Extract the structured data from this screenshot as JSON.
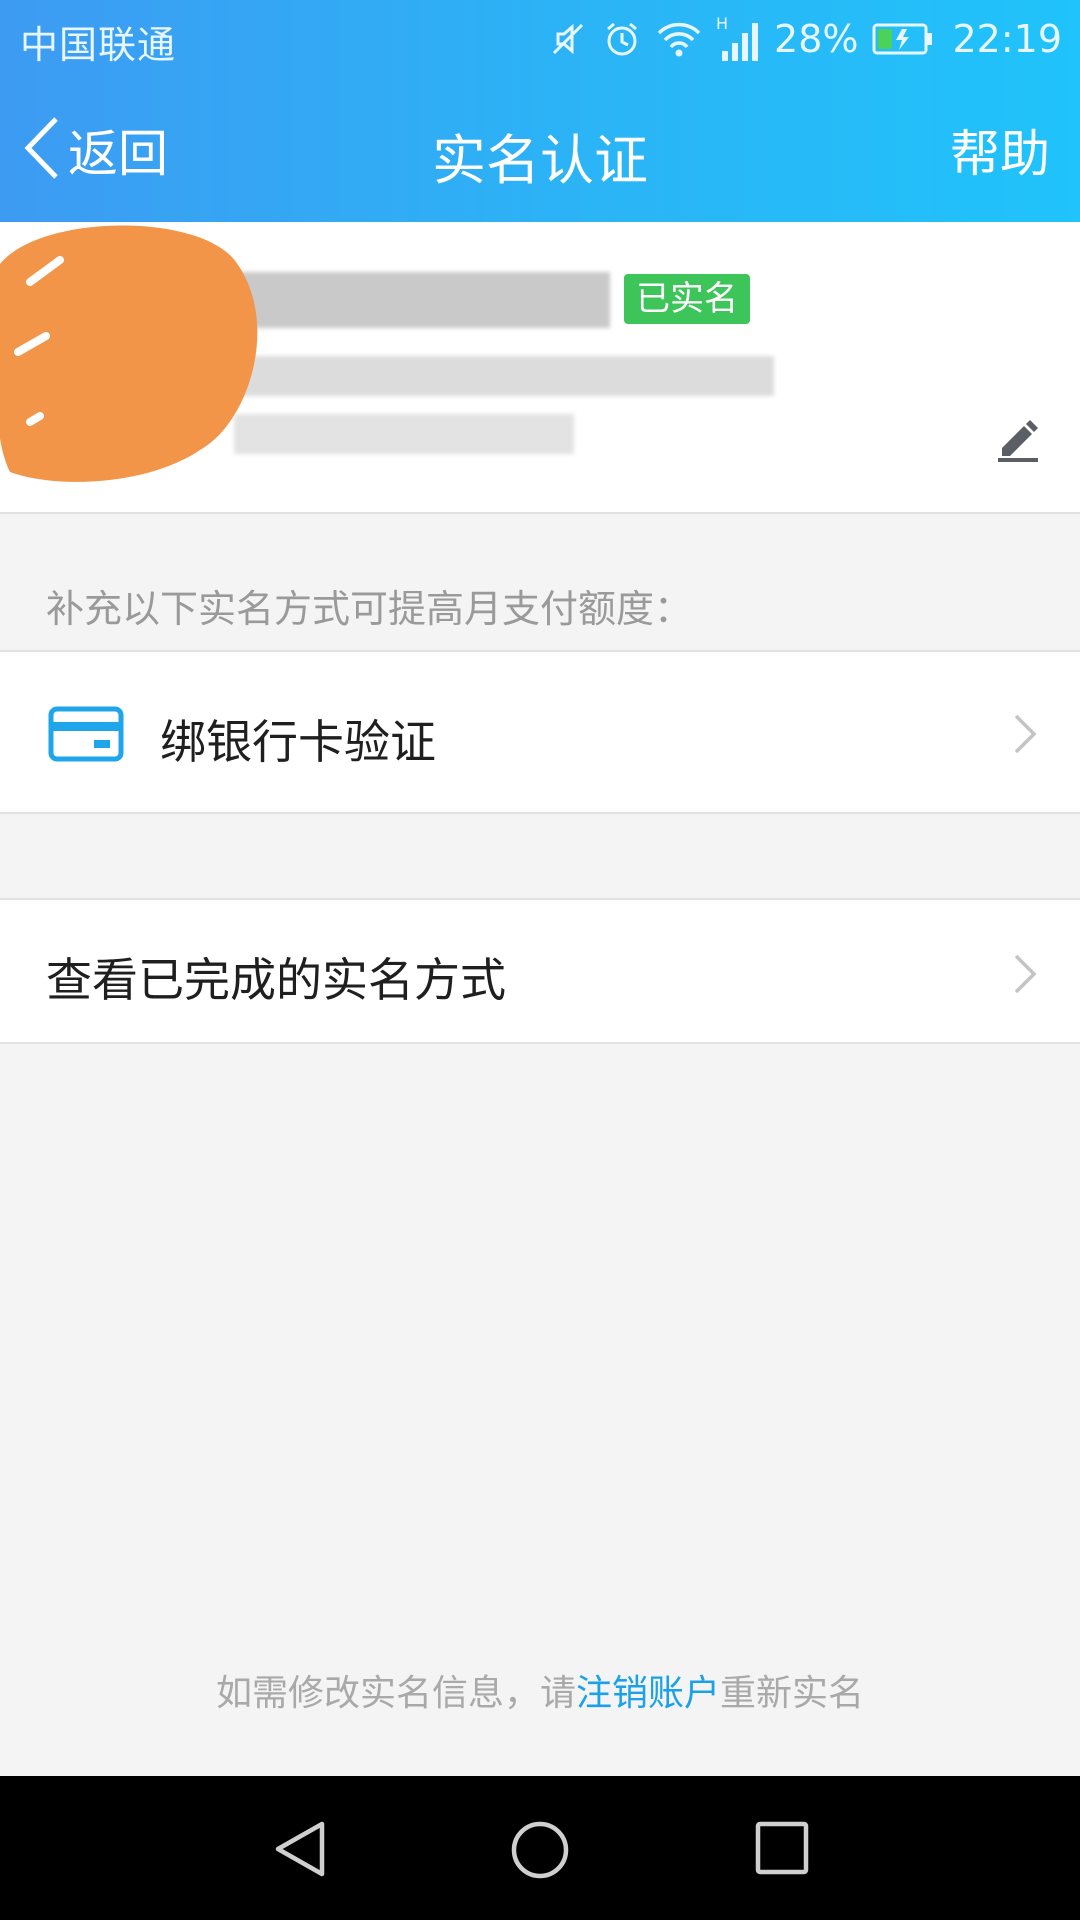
{
  "status_bar": {
    "carrier": "中国联通",
    "network_type": "H",
    "battery_percent": "28%",
    "time": "22:19",
    "icons": [
      "mute-icon",
      "alarm-icon",
      "wifi-icon",
      "signal-icon",
      "battery-charging-icon"
    ]
  },
  "nav": {
    "back_label": "返回",
    "title": "实名认证",
    "help_label": "帮助"
  },
  "profile": {
    "verified_badge": "已实名",
    "edit_icon": "pencil-icon"
  },
  "section_hint": "补充以下实名方式可提高月支付额度：",
  "rows": {
    "bank_card": {
      "label": "绑银行卡验证",
      "icon": "bank-card-icon"
    },
    "view_completed": {
      "label": "查看已完成的实名方式"
    }
  },
  "footer": {
    "prefix": "如需修改实名信息，请",
    "link": "注销账户",
    "suffix": "重新实名"
  },
  "colors": {
    "header_gradient_start": "#3d9bf2",
    "header_gradient_end": "#20c3fb",
    "badge_green": "#3ec55a",
    "link_blue": "#1aa1e8",
    "avatar_scribble_orange": "#f39548"
  }
}
